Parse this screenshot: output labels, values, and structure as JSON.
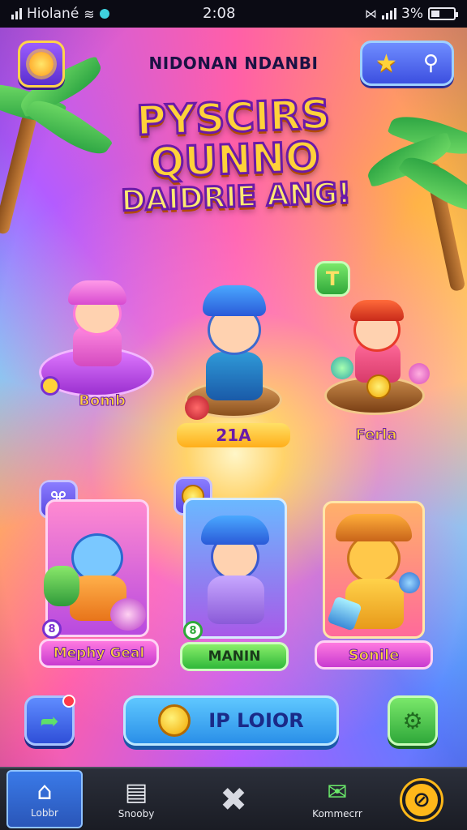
{
  "status_bar": {
    "carrier": "Hiolané",
    "time": "2:08",
    "battery": "3%"
  },
  "header": {
    "title": "NIDONAN NDANBI"
  },
  "logo": {
    "line1": "PYSCIRS",
    "line2": "QUNNO",
    "line3": "DAIDRIE ANG!"
  },
  "featured": [
    {
      "label": "Bomb",
      "badge": ""
    },
    {
      "label": "21A",
      "badge": ""
    },
    {
      "label": "Ferla",
      "badge": "T"
    }
  ],
  "cards": [
    {
      "label": "Mephy Geal",
      "badge": "8"
    },
    {
      "label": "MANIN",
      "badge": "8"
    },
    {
      "label": "Sonile",
      "badge": ""
    }
  ],
  "actions": {
    "play_label": "IP LOIOR"
  },
  "nav": [
    {
      "label": "Lobbr",
      "icon": "home-icon"
    },
    {
      "label": "Snooby",
      "icon": "chart-icon"
    },
    {
      "label": "",
      "icon": "close-icon"
    },
    {
      "label": "Kommecrr",
      "icon": "mail-icon"
    },
    {
      "label": "",
      "icon": "block-icon"
    }
  ],
  "colors": {
    "accent": "#ffd23a",
    "nav_active": "#3a7ae8",
    "play_button": "#2a8fe8",
    "gear_button": "#2fa83a"
  }
}
